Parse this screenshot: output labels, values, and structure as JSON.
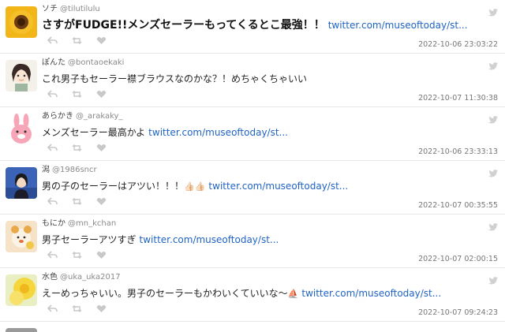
{
  "tweets": [
    {
      "name": "ソチ",
      "handle": "@tilutilulu",
      "text": "さすがFUDGE!!メンズセーラーもってくるとこ最強！！",
      "link": "twitter.com/museoftoday/st...",
      "time": "2022-10-06 23:03:22",
      "avatar": "sunflower-avatar",
      "big": true
    },
    {
      "name": "ぽんた",
      "handle": "@bontaoekaki",
      "text": "これ男子もセーラー襟ブラウスなのかな？！めちゃくちゃいい",
      "link": "",
      "time": "2022-10-07 11:30:38",
      "avatar": "drawn-girl-avatar"
    },
    {
      "name": "あらかき",
      "handle": "@_arakaky_",
      "text": "メンズセーラー最高かよ",
      "link": "twitter.com/museoftoday/st...",
      "time": "2022-10-06 23:33:13",
      "avatar": "pink-rabbit-avatar"
    },
    {
      "name": "潟",
      "handle": "@1986sncr",
      "text": "男の子のセーラーはアツい！！！",
      "emoji": "👍🏻👍🏻",
      "link": "twitter.com/museoftoday/st...",
      "time": "2022-10-07 00:35:55",
      "avatar": "person-avatar"
    },
    {
      "name": "もにか",
      "handle": "@mn_kchan",
      "text": "男子セーラーアツすぎ",
      "link": "twitter.com/museoftoday/st...",
      "time": "2022-10-07 02:00:15",
      "avatar": "cookie-mascot-avatar"
    },
    {
      "name": "水色",
      "handle": "@uka_uka2017",
      "text": "えーめっちゃいい。男子のセーラーもかわいくていいな〜",
      "emoji": "⛵",
      "link": "twitter.com/museoftoday/st...",
      "time": "2022-10-07 09:24:23",
      "avatar": "yellow-flower-avatar"
    }
  ]
}
